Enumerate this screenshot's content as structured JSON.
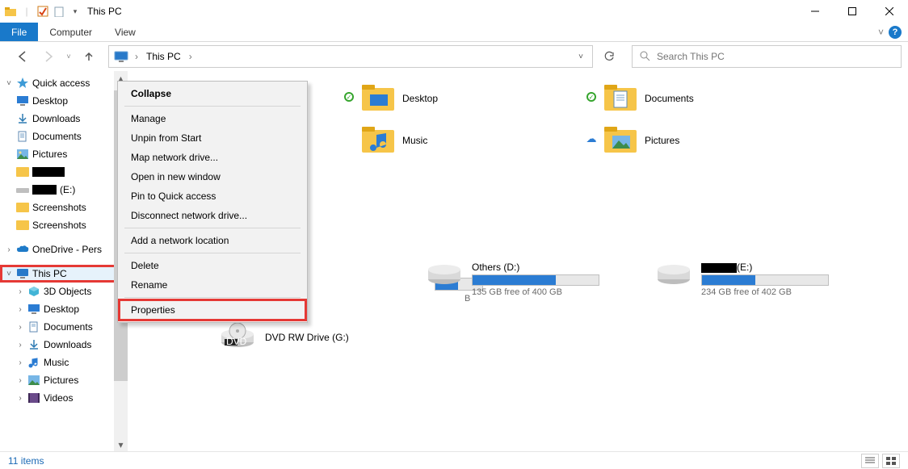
{
  "window": {
    "title": "This PC",
    "min": "–",
    "max": "▢",
    "close": "✕"
  },
  "ribbon": {
    "file": "File",
    "computer": "Computer",
    "view": "View"
  },
  "nav": {
    "address_root": "This PC",
    "refresh": "⟳",
    "search_placeholder": "Search This PC"
  },
  "tree": {
    "quick_access": "Quick access",
    "desktop": "Desktop",
    "downloads": "Downloads",
    "documents": "Documents",
    "pictures": "Pictures",
    "redacted1": "",
    "drive_e_label": "(E:)",
    "screenshots1": "Screenshots",
    "screenshots2": "Screenshots",
    "onedrive": "OneDrive - Pers",
    "this_pc": "This PC",
    "3d_objects": "3D Objects",
    "desktop2": "Desktop",
    "documents2": "Documents",
    "downloads2": "Downloads",
    "music2": "Music",
    "pictures2": "Pictures",
    "videos2": "Videos"
  },
  "folders": {
    "desktop": "Desktop",
    "documents": "Documents",
    "music": "Music",
    "pictures": "Pictures"
  },
  "drives": {
    "d": {
      "name": "Others (D:)",
      "free": "135 GB free of 400 GB",
      "fill_pct": 66
    },
    "e": {
      "name_suffix": "(E:)",
      "free": "234 GB free of 402 GB",
      "fill_pct": 42
    },
    "behind_suffix": "B",
    "dvd": "DVD RW Drive (G:)"
  },
  "context_menu": {
    "collapse": "Collapse",
    "manage": "Manage",
    "unpin": "Unpin from Start",
    "map_drive": "Map network drive...",
    "open_new": "Open in new window",
    "pin_quick": "Pin to Quick access",
    "disconnect": "Disconnect network drive...",
    "add_loc": "Add a network location",
    "delete": "Delete",
    "rename": "Rename",
    "properties": "Properties"
  },
  "status": {
    "items": "11 items"
  }
}
